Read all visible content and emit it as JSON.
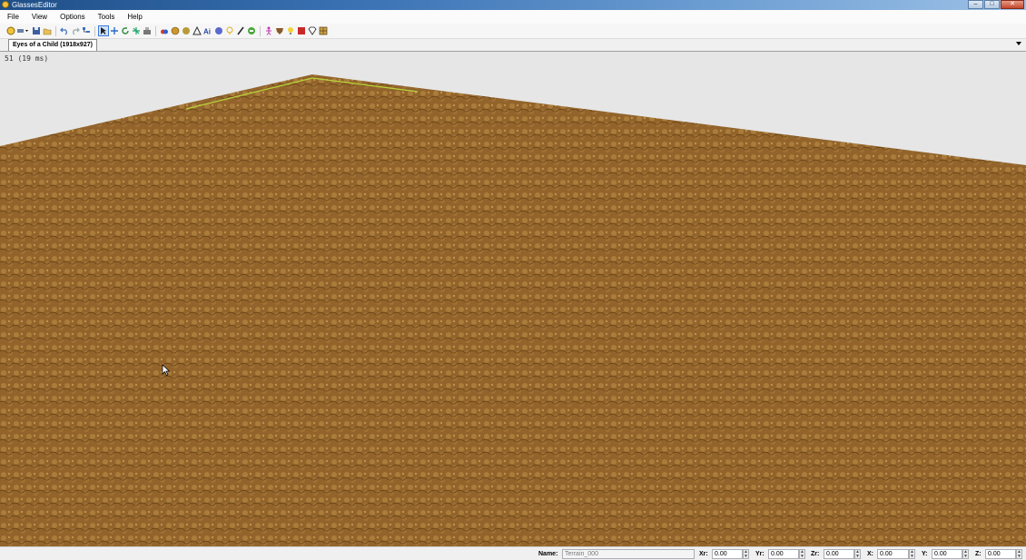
{
  "window": {
    "title": "GlassesEditor",
    "controls": [
      "minimize",
      "maximize",
      "close"
    ]
  },
  "menu": [
    "File",
    "View",
    "Options",
    "Tools",
    "Help"
  ],
  "toolbar": {
    "groups": [
      [
        "open-scene-icon",
        "dropdown-arrow-icon",
        "save-icon",
        "open-folder-icon"
      ],
      [
        "undo-icon",
        "redo-icon",
        "hierarchy-icon"
      ],
      [
        "select-arrow-icon",
        "move-icon",
        "rotate-icon",
        "scale-icon",
        "terrain-tool-icon"
      ],
      [
        "add-objects-icon",
        "add-mesh-icon",
        "add-sphere-icon",
        "add-tree-icon",
        "ai-icon",
        "add-circle-icon",
        "add-light-icon",
        "paint-brush-icon",
        "add-trigger-icon"
      ],
      [
        "add-character-icon",
        "add-shield-icon",
        "add-bulb-icon",
        "add-box-icon",
        "add-gem-icon",
        "add-grid-icon"
      ]
    ],
    "selected": "select-arrow-icon"
  },
  "tab": {
    "label": "Eyes of a Child (1918x927)"
  },
  "viewport": {
    "fps_text": "51 (19 ms)",
    "ground_color": "#9a6a2e",
    "sky_color": "#e6e6e6",
    "edge_highlight": "#b8d43a"
  },
  "status": {
    "name_label": "Name:",
    "name_value": "Terrain_000",
    "fields": [
      {
        "label": "Xr:",
        "value": "0.00"
      },
      {
        "label": "Yr:",
        "value": "0.00"
      },
      {
        "label": "Zr:",
        "value": "0.00"
      },
      {
        "label": "X:",
        "value": "0.00"
      },
      {
        "label": "Y:",
        "value": "0.00"
      },
      {
        "label": "Z:",
        "value": "0.00"
      }
    ]
  }
}
